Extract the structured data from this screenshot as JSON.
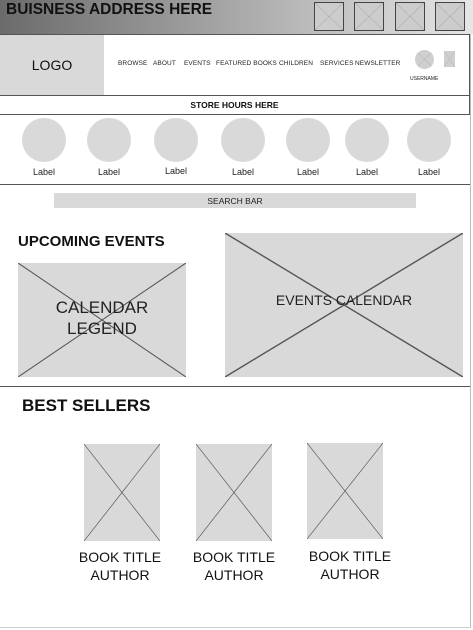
{
  "header": {
    "business_address": "BUISNESS ADDRESS HERE",
    "top_icons": [
      "image-placeholder-icon",
      "image-placeholder-icon",
      "image-placeholder-icon",
      "image-placeholder-icon"
    ]
  },
  "nav": {
    "logo": "LOGO",
    "items": [
      "BROWSE",
      "ABOUT",
      "EVENTS",
      "FEATURED BOOKS",
      "CHILDREN",
      "SERVICES",
      "NEWSLETTER"
    ],
    "username": "USERNAME"
  },
  "store_hours": "STORE HOURS HERE",
  "categories": [
    "Label",
    "Label",
    "Label",
    "Label",
    "Label",
    "Label",
    "Label"
  ],
  "search": {
    "label": "SEARCH BAR"
  },
  "events": {
    "heading": "UPCOMING EVENTS",
    "legend_label": "CALENDAR LEGEND",
    "calendar_label": "EVENTS CALENDAR"
  },
  "bestsellers": {
    "heading": "BEST SELLERS",
    "books": [
      {
        "title": "BOOK TITLE",
        "author": "AUTHOR"
      },
      {
        "title": "BOOK TITLE",
        "author": "AUTHOR"
      },
      {
        "title": "BOOK TITLE",
        "author": "AUTHOR"
      }
    ]
  },
  "colors": {
    "header_gradient_dark": "#6b6b6b",
    "header_gradient_light": "#e6e6e6",
    "placeholder_fill": "#d9d9d9",
    "rule_color": "#555555"
  }
}
